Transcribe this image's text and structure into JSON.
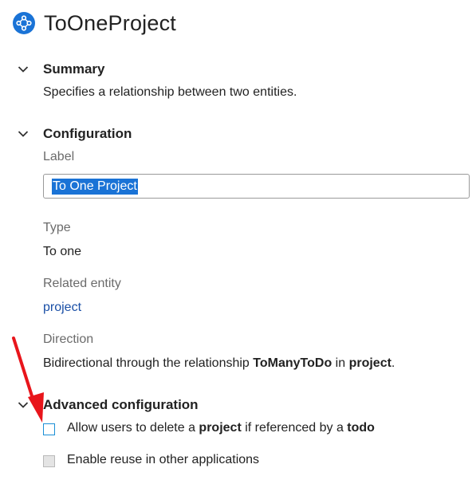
{
  "header": {
    "title": "ToOneProject",
    "icon": "relationship-icon",
    "accent": "#1a73d6"
  },
  "summary": {
    "title": "Summary",
    "description": "Specifies a relationship between two entities."
  },
  "configuration": {
    "title": "Configuration",
    "label_caption": "Label",
    "label_value": "To One Project",
    "type_caption": "Type",
    "type_value": "To one",
    "related_caption": "Related entity",
    "related_value": "project",
    "direction_caption": "Direction",
    "direction_prefix": "Bidirectional through the relationship ",
    "direction_relationship": "ToManyToDo",
    "direction_in": " in ",
    "direction_entity": "project",
    "direction_suffix": "."
  },
  "advanced": {
    "title": "Advanced configuration",
    "delete_option": {
      "prefix": "Allow users to delete a ",
      "entity": "project",
      "middle": " if referenced by a ",
      "referrer": "todo",
      "checked": false
    },
    "reuse_option": {
      "label": "Enable reuse in other applications",
      "checked": false,
      "disabled": true
    }
  },
  "annotation": {
    "arrow_color": "#e8151b"
  }
}
